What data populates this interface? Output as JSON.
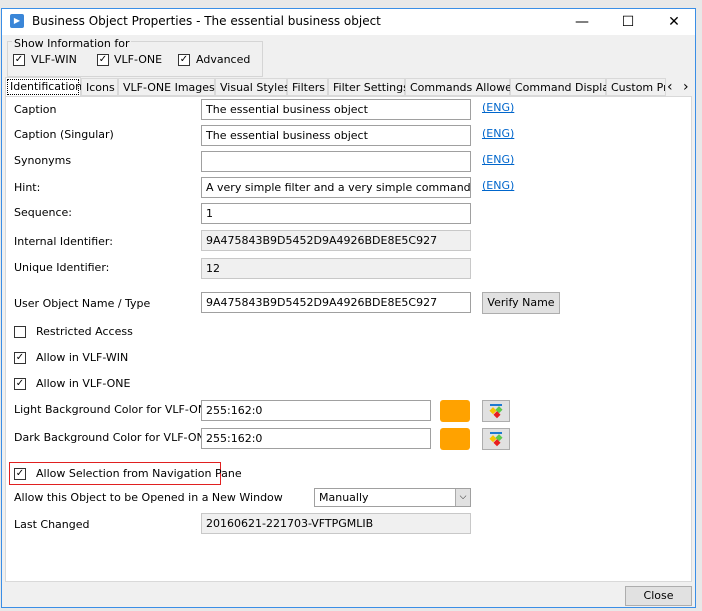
{
  "window": {
    "title": "Business Object Properties - The essential business object",
    "minimize": "—",
    "maximize": "☐",
    "close": "✕"
  },
  "show_info": {
    "label": "Show Information for",
    "options": [
      {
        "label": "VLF-WIN",
        "checked": true
      },
      {
        "label": "VLF-ONE",
        "checked": true
      },
      {
        "label": "Advanced",
        "checked": true
      }
    ]
  },
  "tabs": [
    "Identification",
    "Icons",
    "VLF-ONE Images",
    "Visual Styles",
    "Filters",
    "Filter Settings",
    "Commands Allowed",
    "Command Display",
    "Custom Pr"
  ],
  "tab_scroll": {
    "left": "‹",
    "right": "›"
  },
  "fields": {
    "caption": {
      "label": "Caption",
      "value": "The essential business object",
      "link": "(ENG)"
    },
    "caption_singular": {
      "label": "Caption (Singular)",
      "value": "The essential business object",
      "link": "(ENG)"
    },
    "synonyms": {
      "label": "Synonyms",
      "value": "",
      "link": "(ENG)"
    },
    "hint": {
      "label": "Hint:",
      "value": "A very simple filter and a very simple command handler",
      "link": "(ENG)"
    },
    "sequence": {
      "label": "Sequence:",
      "value": "1"
    },
    "internal_id": {
      "label": "Internal Identifier:",
      "value": "9A475843B9D5452D9A4926BDE8E5C927"
    },
    "unique_id": {
      "label": "Unique Identifier:",
      "value": "12"
    },
    "user_object": {
      "label": "User Object Name / Type",
      "value": "9A475843B9D5452D9A4926BDE8E5C927",
      "button": "Verify Name"
    },
    "restricted": {
      "label": "Restricted Access",
      "checked": false
    },
    "allow_win": {
      "label": "Allow in VLF-WIN",
      "checked": true
    },
    "allow_one": {
      "label": "Allow in VLF-ONE",
      "checked": true
    },
    "light_bg": {
      "label": "Light Background Color for VLF-ONE",
      "value": "255:162:0",
      "color": "#ffa200"
    },
    "dark_bg": {
      "label": "Dark Background Color for VLF-ONE",
      "value": "255:162:0",
      "color": "#ffa200"
    },
    "allow_nav": {
      "label": "Allow Selection from Navigation Pane",
      "checked": true
    },
    "new_window": {
      "label": "Allow this Object to be Opened in a New Window",
      "value": "Manually"
    },
    "last_changed": {
      "label": "Last Changed",
      "value": "20160621-221703-VFTPGMLIB"
    }
  },
  "footer": {
    "close": "Close"
  }
}
